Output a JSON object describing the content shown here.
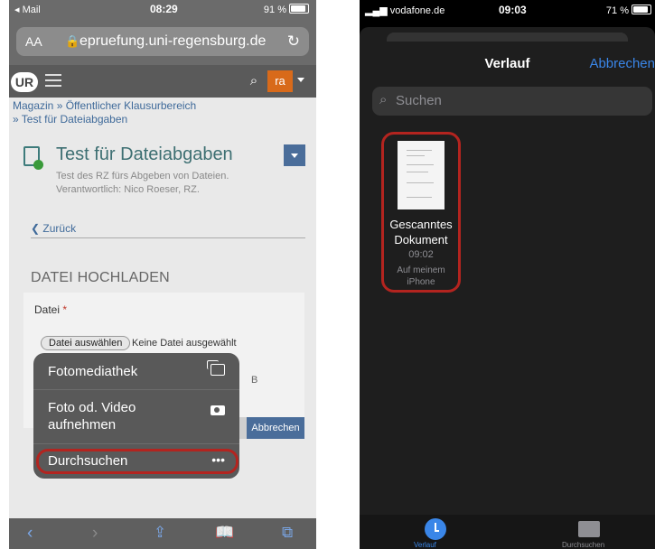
{
  "left": {
    "status": {
      "carrier": "◂ Mail",
      "time": "08:29",
      "battery": "91 %"
    },
    "url": {
      "aa": "AA",
      "host": "epruefung.uni-regensburg.de"
    },
    "nav": {
      "logo": "UR",
      "user": "ra"
    },
    "breadcrumb": {
      "line1": "Magazin » Öffentlicher Klausurbereich",
      "line2": "» Test für Dateiabgaben"
    },
    "course": {
      "title": "Test für Dateiabgaben",
      "desc1": "Test des RZ fürs Abgeben von Dateien.",
      "desc2": "Verantwortlich: Nico Roeser, RZ."
    },
    "back": "Zurück",
    "heading": "DATEI HOCHLADEN",
    "field": {
      "label": "Datei",
      "required": "*",
      "button": "Datei auswählen",
      "nofile": "Keine Datei ausgewählt",
      "size_suffix": "B"
    },
    "cancel": "Abbrechen",
    "popup": {
      "item1": "Fotomediathek",
      "item2a": "Foto od. Video",
      "item2b": "aufnehmen",
      "item3": "Durchsuchen",
      "item3_icon": "•••"
    },
    "toolbar": [
      "back-icon",
      "forward-icon",
      "share-icon",
      "bookmarks-icon",
      "tabs-icon"
    ]
  },
  "right": {
    "status": {
      "carrier": "vodafone.de",
      "time": "09:03",
      "battery": "71 %"
    },
    "title": "Verlauf",
    "cancel": "Abbrechen",
    "search_placeholder": "Suchen",
    "file": {
      "name1": "Gescanntes",
      "name2": "Dokument",
      "time": "09:02",
      "loc1": "Auf meinem",
      "loc2": "iPhone"
    },
    "tabs": {
      "recent": "Verlauf",
      "browse": "Durchsuchen"
    }
  },
  "colors": {
    "highlight": "#b3241f",
    "link": "#3f6a9a",
    "ios_blue": "#3a86e8",
    "user_orange": "#d86a1a"
  }
}
